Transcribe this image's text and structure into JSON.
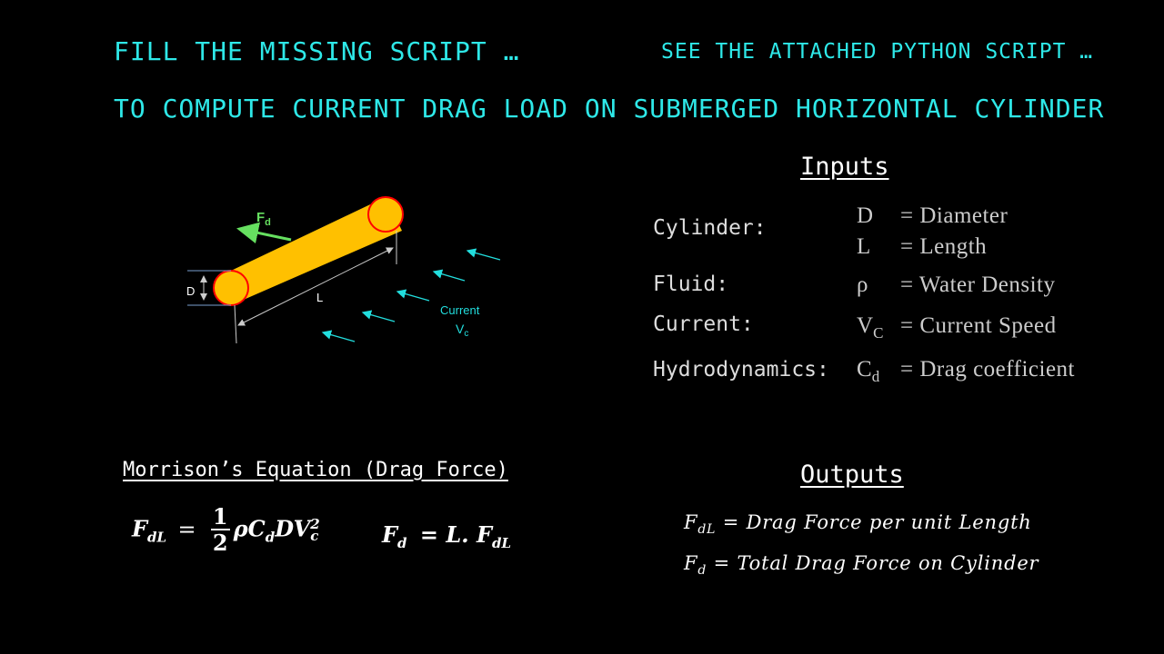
{
  "titles": {
    "line1_left": "FILL THE MISSING SCRIPT …",
    "line1_right": "SEE THE ATTACHED PYTHON SCRIPT …",
    "line2": "TO COMPUTE CURRENT DRAG LOAD ON SUBMERGED HORIZONTAL CYLINDER"
  },
  "diagram": {
    "fd_label": "F",
    "fd_sub": "d",
    "d_label": "D",
    "l_label": "L",
    "current_label": "Current",
    "vc_label": "V",
    "vc_sub": "c"
  },
  "inputs": {
    "heading": "Inputs",
    "rows": [
      {
        "category": "Cylinder:",
        "symbol": "D",
        "symbol_sub": "",
        "definition": "= Diameter"
      },
      {
        "category": "",
        "symbol": "L",
        "symbol_sub": "",
        "definition": "= Length"
      },
      {
        "category": "Fluid:",
        "symbol": "ρ",
        "symbol_sub": "",
        "definition": "= Water Density"
      },
      {
        "category": "Current:",
        "symbol": "V",
        "symbol_sub": "C",
        "definition": "= Current Speed"
      },
      {
        "category": "Hydrodynamics:",
        "symbol": "C",
        "symbol_sub": "d",
        "definition": "= Drag coefficient"
      }
    ]
  },
  "morrison": {
    "heading": "Morrison’s Equation (Drag Force)",
    "eq1_lhs": "F",
    "eq1_lhs_sub": "dL",
    "eq1_equals": "=",
    "eq1_num": "1",
    "eq1_den": "2",
    "eq1_rhs": "ρC",
    "eq1_rhs_sub": "d",
    "eq1_rhs2": "DV",
    "eq1_sup": "2",
    "eq1_sub2": "c",
    "eq2_lhs": "F",
    "eq2_lhs_sub": "d",
    "eq2_rhs": "= L. F",
    "eq2_rhs_sub": "dL"
  },
  "outputs": {
    "heading": "Outputs",
    "line1_sym": "F",
    "line1_sub": "dL",
    "line1_text": " = Drag Force per unit Length",
    "line2_sym": "F",
    "line2_sub": "d",
    "line2_text": " = Total Drag Force on Cylinder"
  },
  "colors": {
    "title": "#2ee8e8",
    "cylinder_fill": "#ffc000",
    "cylinder_outline": "#ff0000",
    "force_arrow": "#66e060",
    "current_arrow": "#22dddd",
    "dimension": "#cccccc"
  }
}
